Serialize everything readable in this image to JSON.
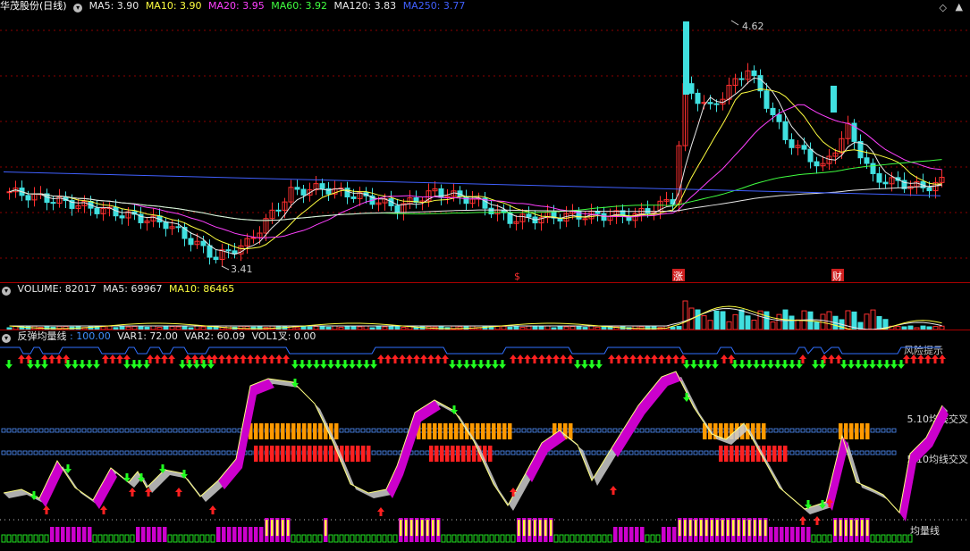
{
  "price_panel": {
    "title": "华茂股份(日线)",
    "indicators": [
      {
        "label": "MA5: 3.90",
        "color": "#e8e8e8"
      },
      {
        "label": "MA10: 3.90",
        "color": "#ffff40"
      },
      {
        "label": "MA20: 3.95",
        "color": "#ff40ff"
      },
      {
        "label": "MA60: 3.92",
        "color": "#40ff40"
      },
      {
        "label": "MA120: 3.83",
        "color": "#e8e8e8"
      },
      {
        "label": "MA250: 3.77",
        "color": "#4060ff"
      }
    ],
    "high_label": "4.62",
    "low_label": "3.41",
    "markers": [
      {
        "text": "$",
        "color": "#ff3030"
      },
      {
        "text": "涨",
        "color": "#ffffff"
      },
      {
        "text": "财",
        "color": "#ffffff"
      }
    ]
  },
  "volume_panel": {
    "indicators": [
      {
        "label": "VOLUME: 82017",
        "color": "#e8e8e8"
      },
      {
        "label": "MA5: 69967",
        "color": "#e8e8e8"
      },
      {
        "label": "MA10: 86465",
        "color": "#ffff40"
      }
    ]
  },
  "indicator_panel": {
    "name": "反弹均量线",
    "values": [
      {
        "label": ": 100.00",
        "color": "#4090ff"
      },
      {
        "label": "VAR1: 72.00",
        "color": "#e8e8e8"
      },
      {
        "label": "VAR2: 60.09",
        "color": "#e8e8e8"
      },
      {
        "label": "VOL1叉: 0.00",
        "color": "#e8e8e8"
      }
    ],
    "top_right_label": "风险提示",
    "cross_label_1": "5.10均线交叉",
    "cross_label_2": "5.10均线交叉",
    "bottom_label": "均量线"
  },
  "colors": {
    "up": "#ff3030",
    "down": "#40e0e0",
    "grid": "#8b0000",
    "magenta": "#cc00cc",
    "orange": "#ff9900",
    "red_bar": "#ff2020",
    "green_arrow": "#20ff20",
    "blue_line": "#3070ff"
  }
}
